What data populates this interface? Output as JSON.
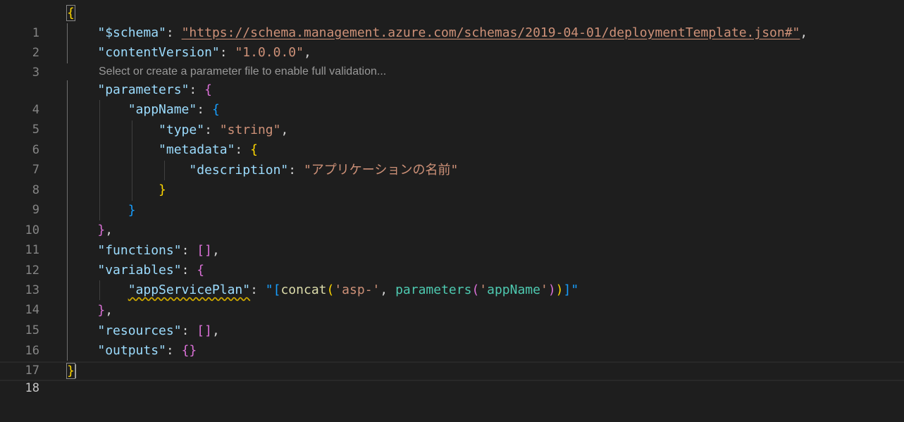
{
  "editor": {
    "language": "json",
    "active_line": "18",
    "codelens": "Select or create a parameter file to enable full validation...",
    "line_numbers": [
      "1",
      "2",
      "3",
      "4",
      "5",
      "6",
      "7",
      "8",
      "9",
      "10",
      "11",
      "12",
      "13",
      "14",
      "15",
      "16",
      "17",
      "18"
    ],
    "tokens": {
      "open_brace": "{",
      "close_brace": "}",
      "schema_key": "\"$schema\"",
      "schema_url": "\"https://schema.management.azure.com/schemas/2019-04-01/deploymentTemplate.json#\"",
      "content_version_key": "\"contentVersion\"",
      "content_version_val": "\"1.0.0.0\"",
      "parameters_key": "\"parameters\"",
      "app_name_key": "\"appName\"",
      "type_key": "\"type\"",
      "type_val": "\"string\"",
      "metadata_key": "\"metadata\"",
      "description_key": "\"description\"",
      "description_val": "\"アプリケーションの名前\"",
      "functions_key": "\"functions\"",
      "variables_key": "\"variables\"",
      "app_service_plan_key": "\"appServicePlan\"",
      "expr_open": "\"[",
      "expr_concat": "concat",
      "expr_asp": "'asp-'",
      "expr_params": "parameters",
      "expr_appname": "appName",
      "expr_close": "]\"",
      "resources_key": "\"resources\"",
      "outputs_key": "\"outputs\""
    }
  }
}
